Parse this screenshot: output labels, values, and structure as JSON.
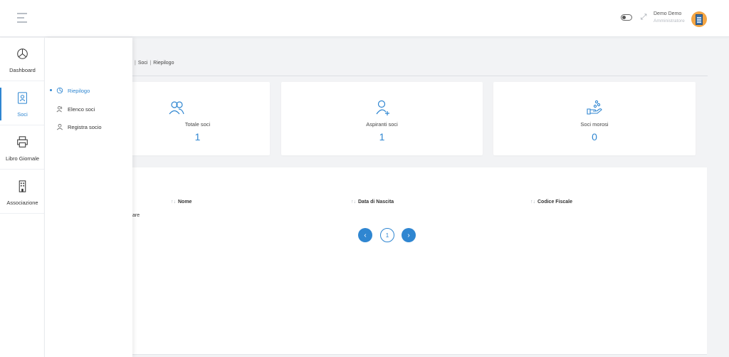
{
  "header": {
    "user_name": "Demo Demo",
    "user_role": "Amministratore"
  },
  "rail": {
    "items": [
      {
        "label": "Dashboard",
        "icon": "dashboard-icon",
        "active": false
      },
      {
        "label": "Soci",
        "icon": "badge-icon",
        "active": true
      },
      {
        "label": "Libro Giornale",
        "icon": "printer-icon",
        "active": false
      },
      {
        "label": "Associazione",
        "icon": "building-icon",
        "active": false
      }
    ]
  },
  "submenu": {
    "items": [
      {
        "label": "Riepilogo",
        "icon": "chart-icon",
        "active": true
      },
      {
        "label": "Elenco soci",
        "icon": "users-icon",
        "active": false
      },
      {
        "label": "Registra socio",
        "icon": "user-icon",
        "active": false
      }
    ]
  },
  "breadcrumb": {
    "items": [
      "Soci",
      "Riepilogo"
    ]
  },
  "cards": [
    {
      "label": "Totale soci",
      "value": "1",
      "icon": "users-icon"
    },
    {
      "label": "Aspiranti soci",
      "value": "1",
      "icon": "user-add-icon"
    },
    {
      "label": "Soci morosi",
      "value": "0",
      "icon": "hand-coins-icon"
    }
  ],
  "table": {
    "columns": [
      "Nome",
      "Data di Nascita",
      "Codice Fiscale"
    ],
    "sort_glyph": "↑↓",
    "partial_row_text": "are"
  },
  "pagination": {
    "prev": "‹",
    "current": "1",
    "next": "›"
  },
  "colors": {
    "accent": "#2f86d1",
    "background": "#f2f3f5"
  }
}
